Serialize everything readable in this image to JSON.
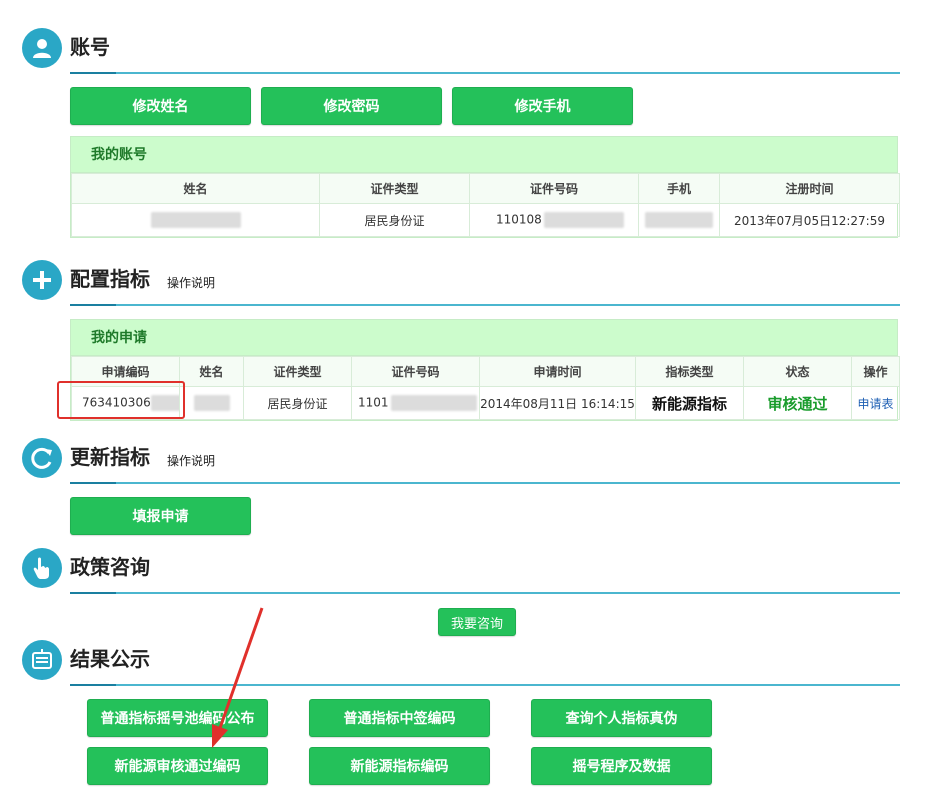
{
  "account": {
    "title": "账号",
    "buttons": [
      "修改姓名",
      "修改密码",
      "修改手机"
    ],
    "panel_title": "我的账号",
    "columns": [
      "姓名",
      "证件类型",
      "证件号码",
      "手机",
      "注册时间"
    ],
    "row": {
      "id_type": "居民身份证",
      "id_number_prefix": "110108",
      "register_time": "2013年07月05日12:27:59"
    }
  },
  "config": {
    "title": "配置指标",
    "note": "操作说明",
    "panel_title": "我的申请",
    "columns": [
      "申请编码",
      "姓名",
      "证件类型",
      "证件号码",
      "申请时间",
      "指标类型",
      "状态",
      "操作"
    ],
    "row": {
      "code_prefix": "763410306",
      "id_type": "居民身份证",
      "id_number_prefix": "1101",
      "apply_time": "2014年08月11日 16:14:15",
      "quota_type": "新能源指标",
      "status": "审核通过",
      "action": "申请表"
    }
  },
  "update": {
    "title": "更新指标",
    "note": "操作说明",
    "button": "填报申请"
  },
  "policy": {
    "title": "政策咨询",
    "button": "我要咨询"
  },
  "results": {
    "title": "结果公示",
    "buttons": [
      "普通指标摇号池编码公布",
      "普通指标中签编码",
      "查询个人指标真伪",
      "新能源审核通过编码",
      "新能源指标编码",
      "摇号程序及数据"
    ]
  },
  "colors": {
    "button_green": "#24c15a",
    "icon_teal": "#2aa7c6",
    "panel_head_bg": "#ccfccc",
    "highlight_red": "#e0302b"
  },
  "icons": [
    "user-icon",
    "plus-icon",
    "refresh-icon",
    "pointer-hand-icon",
    "bulletin-icon",
    "red-arrow-annotation"
  ]
}
